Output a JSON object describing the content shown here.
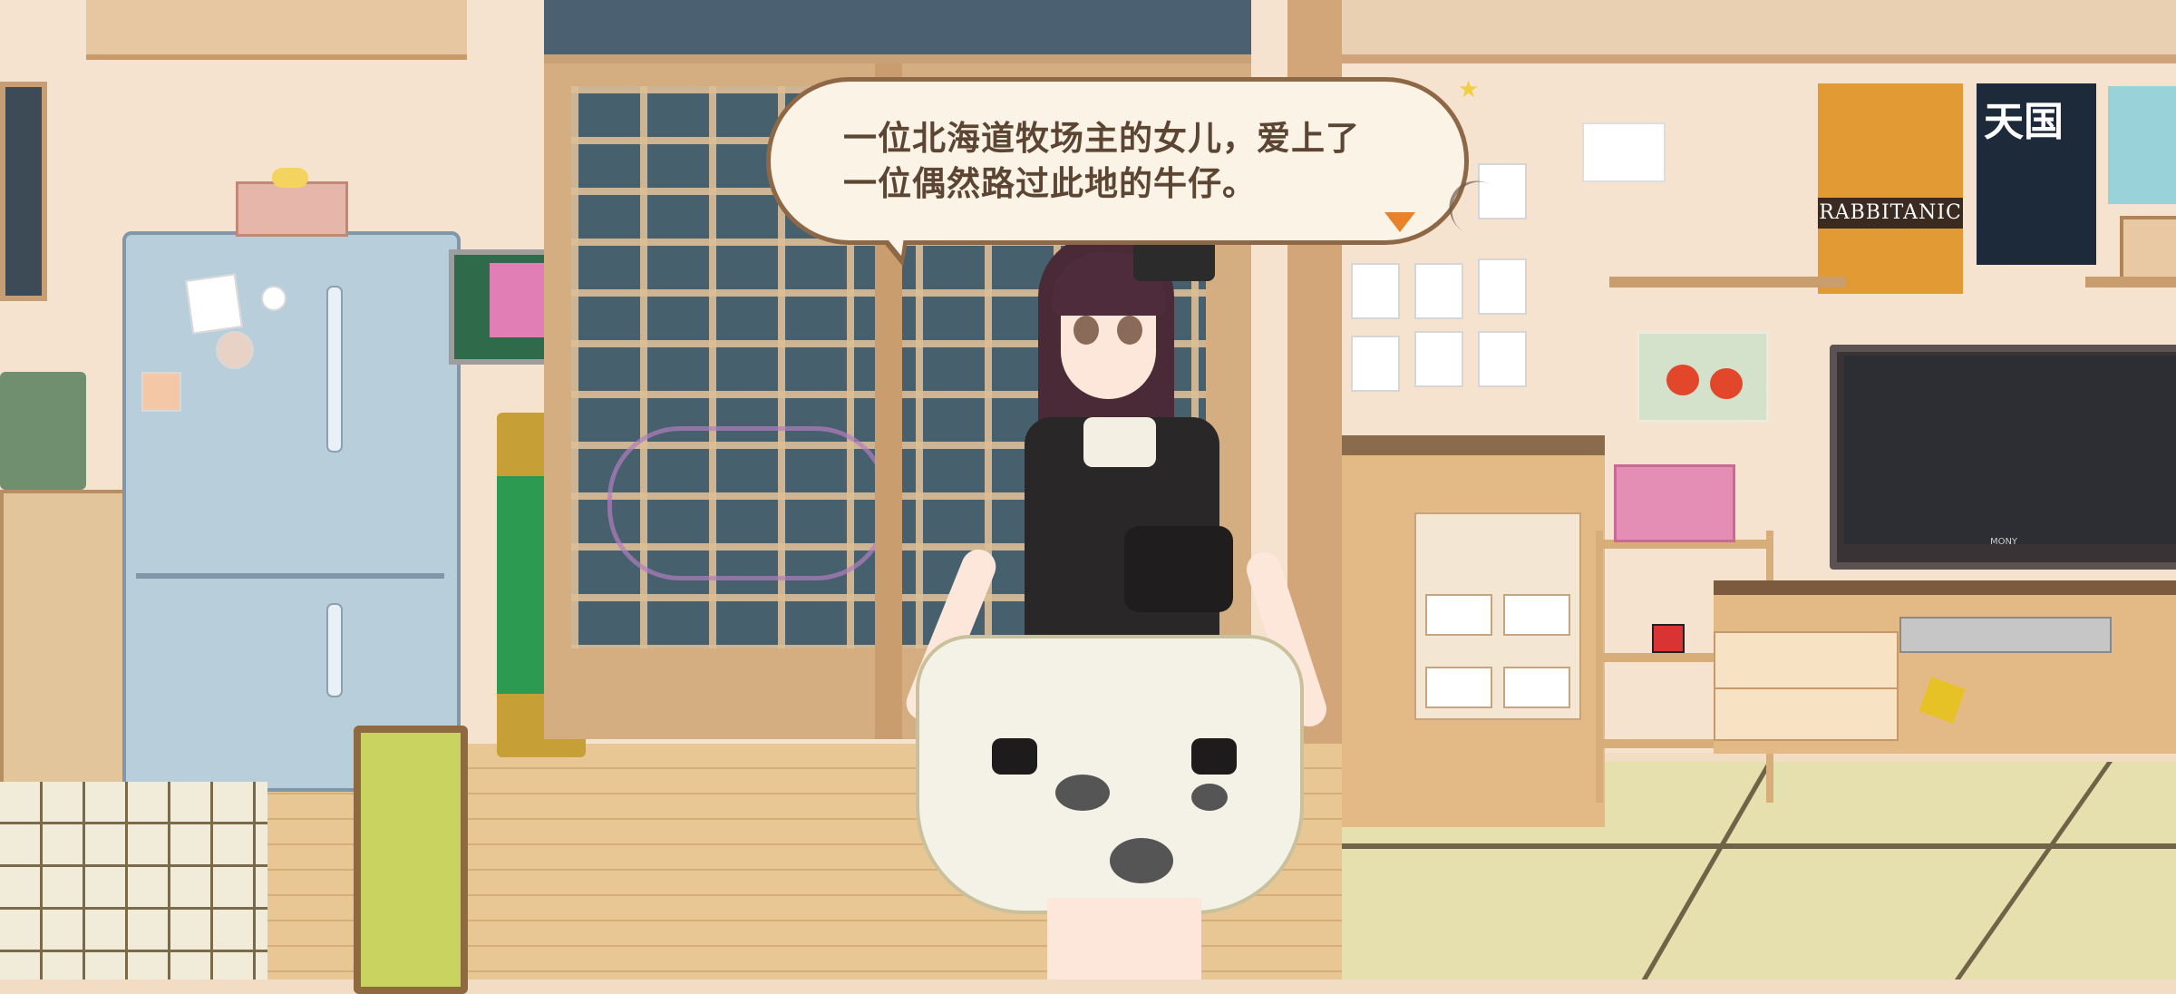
{
  "dialogue": {
    "line_1": "一位北海道牧场主的女儿，爱上了",
    "line_2": "一位偶然路过此地的牛仔。",
    "advance_icon": "triangle-down-icon",
    "advance_color": "#e8822a"
  },
  "room": {
    "poster_rabbit_title": "RABBITANIC",
    "poster_tengoku_title": "天国",
    "tv_brand": "MONY"
  },
  "colors": {
    "bubble_fill": "#fbf3e6",
    "bubble_border": "#8e6846",
    "dialogue_text": "#5c4633"
  }
}
